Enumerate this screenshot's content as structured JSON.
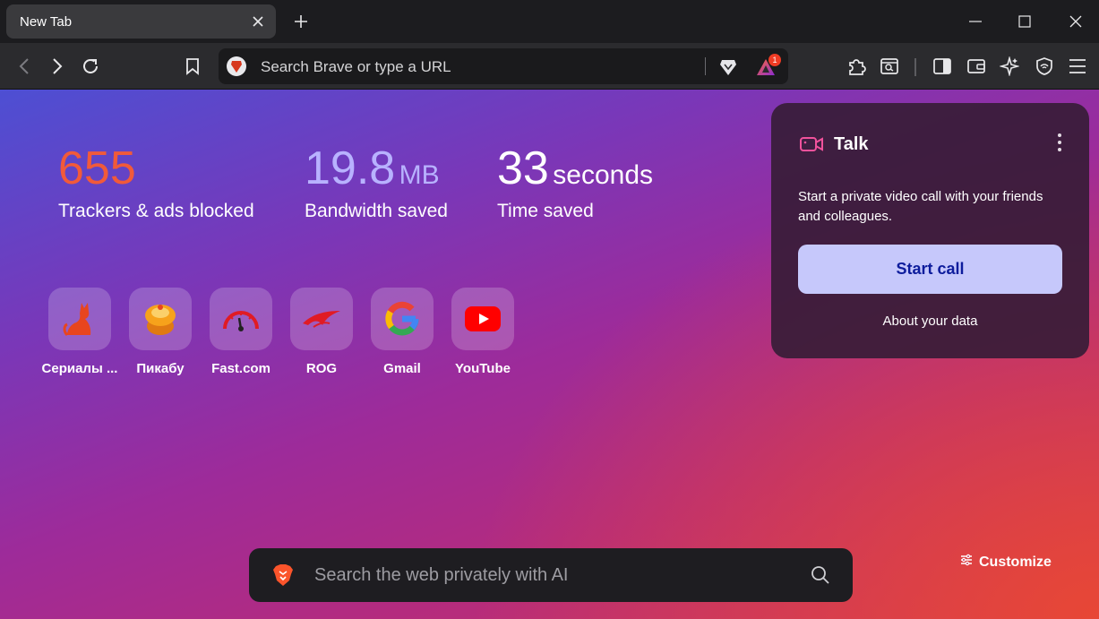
{
  "tab": {
    "title": "New Tab",
    "close_icon": "close-icon",
    "new_tab_icon": "plus-icon"
  },
  "window_controls": [
    "minimize-icon",
    "maximize-icon",
    "close-icon"
  ],
  "toolbar": {
    "url_placeholder": "Search Brave or type a URL",
    "notification_count": "1"
  },
  "stats": {
    "trackers": {
      "value": "655",
      "unit": "",
      "label": "Trackers & ads blocked",
      "color": "#f15a3a"
    },
    "bandwidth": {
      "value": "19.8",
      "unit": "MB",
      "label": "Bandwidth saved",
      "color": "#b8b2ff"
    },
    "time": {
      "value": "33",
      "unit": "seconds",
      "label": "Time saved",
      "color": "#ffffff"
    }
  },
  "top_sites": [
    {
      "label": "Сериалы ...",
      "icon": "cat-icon"
    },
    {
      "label": "Пикабу",
      "icon": "pikabu-icon"
    },
    {
      "label": "Fast.com",
      "icon": "speedometer-icon"
    },
    {
      "label": "ROG",
      "icon": "rog-icon"
    },
    {
      "label": "Gmail",
      "icon": "google-icon"
    },
    {
      "label": "YouTube",
      "icon": "youtube-icon"
    }
  ],
  "talk": {
    "title": "Talk",
    "description": "Start a private video call with your friends and colleagues.",
    "start_call": "Start call",
    "about_data": "About your data"
  },
  "search": {
    "placeholder": "Search the web privately with AI"
  },
  "customize": {
    "label": "Customize"
  },
  "colors": {
    "accent": "#c6c8fb",
    "brave_orange": "#fb542b",
    "badge_red": "#ef3b24"
  }
}
